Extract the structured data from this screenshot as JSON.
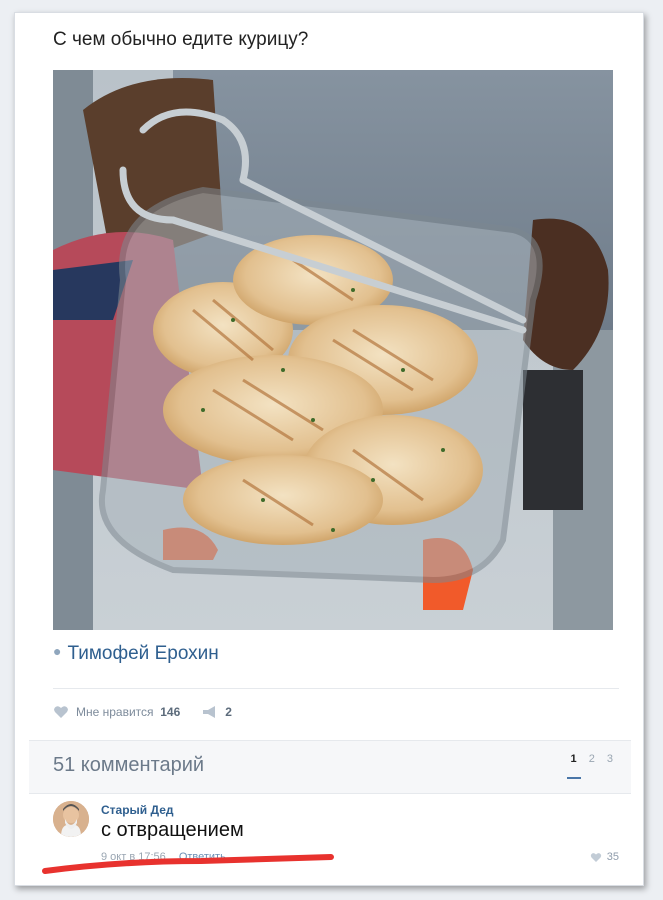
{
  "post": {
    "text": "С чем обычно едите курицу?",
    "author": "Тимофей Ерохин",
    "photo_icon": "photo-chicken-in-glass-dish"
  },
  "actions": {
    "like_label": "Мне нравится",
    "like_count": "146",
    "share_count": "2"
  },
  "comments": {
    "title": "51 комментарий",
    "pages": [
      "1",
      "2",
      "3"
    ],
    "items": [
      {
        "author": "Старый Дед",
        "text": "с отвращением",
        "meta": "9 окт в 17:56",
        "reply": "Ответить",
        "likes": "35"
      }
    ]
  },
  "colors": {
    "accent": "#4a76a8",
    "link": "#2f5f8f",
    "underline": "#e8322e"
  }
}
